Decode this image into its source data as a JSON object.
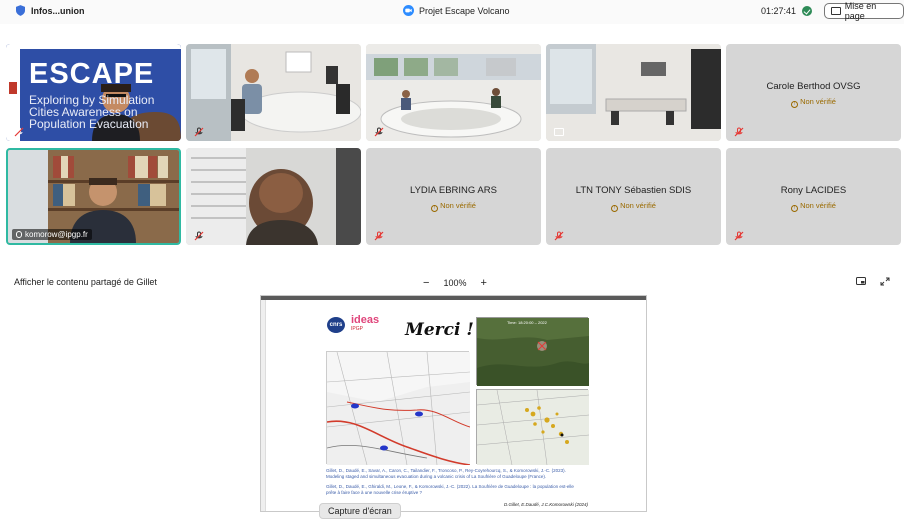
{
  "topbar": {
    "meeting_short": "Infos...union",
    "title": "Projet Escape Volcano",
    "time": "01:27:41",
    "mise_en_page": "Mise en page"
  },
  "tiles": {
    "row1": [
      {
        "type": "video",
        "label": ""
      },
      {
        "type": "video",
        "label": ""
      },
      {
        "type": "video",
        "label": ""
      },
      {
        "type": "video",
        "label": ""
      },
      {
        "type": "name",
        "name": "Carole Berthod OVSG",
        "badge": "Non vérifié"
      }
    ],
    "row2": [
      {
        "type": "video",
        "label": "komorow@ipgp.fr"
      },
      {
        "type": "video",
        "label": ""
      },
      {
        "type": "name",
        "name": "LYDIA EBRING ARS",
        "badge": "Non vérifié"
      },
      {
        "type": "name",
        "name": "LTN TONY Sébastien SDIS",
        "badge": "Non vérifié"
      },
      {
        "type": "name",
        "name": "Rony LACIDES",
        "badge": "Non vérifié"
      }
    ]
  },
  "escape_slide": {
    "title": "ESCAPE",
    "line1": "Exploring by Simulation",
    "line2": "Cities Awareness on",
    "line3": "Population Evacuation"
  },
  "share": {
    "label": "Afficher le contenu partagé de Gillet",
    "zoom": "100%",
    "minus": "−",
    "plus": "+"
  },
  "slide": {
    "cnrs": "cnrs",
    "ideas": "ideas",
    "ideas_sub": "IPGP",
    "merci": "Merci  !",
    "map_label": "Time: 18:20:00 – 2022",
    "ref1": "Gillet, D., Daudé, E., Savar, A., Caron, C., Tailandier, F., Troncoso, P., Rey-Coyrehourcq, S., & Komorowski, J.-C. (2023). Modeling staged and simultaneous evacuation during a volcanic crisis of La Soufrière of Guadeloupe (France).",
    "ref2": "Gillet, D., Daudé, E., Ghiraldi, M., Leone, F., & Komorowski, J.-C. (2022). La Soufrière de Guadeloupe : la population est-elle prête à faire face à une nouvelle crise éruptive ?",
    "footer": "D.Gillet, E.Daudé, J.C.Komorowski (2024)"
  },
  "tooltip": "Capture d'écran",
  "colors": {
    "active_border": "#2fb9a2",
    "badge": "#9a6a00",
    "escape_blue": "#2d4aa0"
  }
}
